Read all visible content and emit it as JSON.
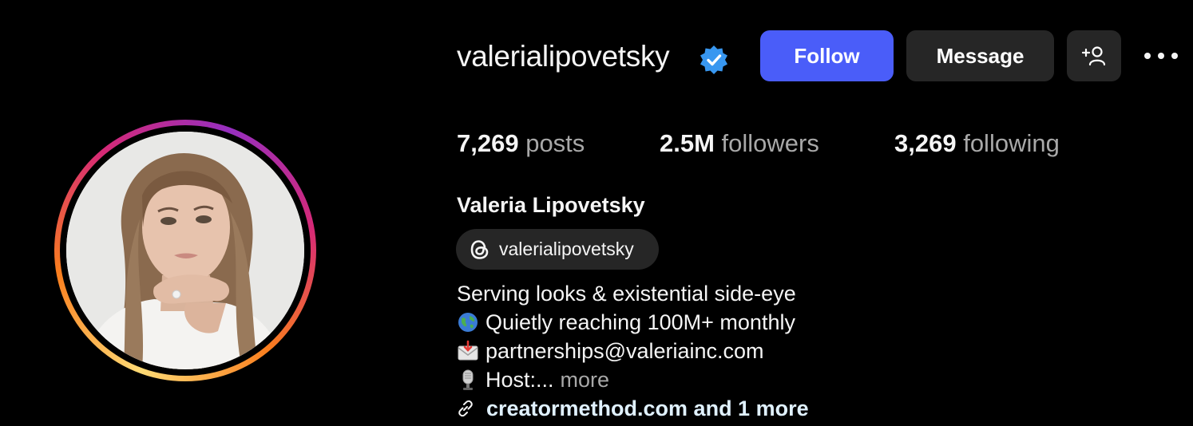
{
  "profile": {
    "username": "valerialipovetsky",
    "verified": true,
    "full_name": "Valeria Lipovetsky",
    "avatar_description_icon": "profile-photo"
  },
  "actions": {
    "follow_label": "Follow",
    "message_label": "Message",
    "suggest_icon": "add-person-icon",
    "more_icon": "ellipsis-icon"
  },
  "stats": [
    {
      "value": "7,269",
      "label": "posts"
    },
    {
      "value": "2.5M",
      "label": "followers"
    },
    {
      "value": "3,269",
      "label": "following"
    }
  ],
  "threads": {
    "icon": "threads-icon",
    "handle": "valerialipovetsky"
  },
  "bio": {
    "line1": "Serving looks & existential side-eye",
    "line2": "Quietly reaching 100M+ monthly",
    "line2_icon": "globe-icon",
    "line3": "partnerships@valeriainc.com",
    "line3_icon": "envelope-icon",
    "line4": "Host:...",
    "line4_icon": "microphone-icon",
    "more_label": "more"
  },
  "link": {
    "icon": "link-icon",
    "text": "creatormethod.com and 1 more"
  },
  "colors": {
    "background": "#000000",
    "follow_button": "#4a5df9",
    "secondary_button": "#262626",
    "verified_badge": "#3897f0",
    "muted_text": "#a8a8a8",
    "link_text": "#e0f1ff"
  }
}
